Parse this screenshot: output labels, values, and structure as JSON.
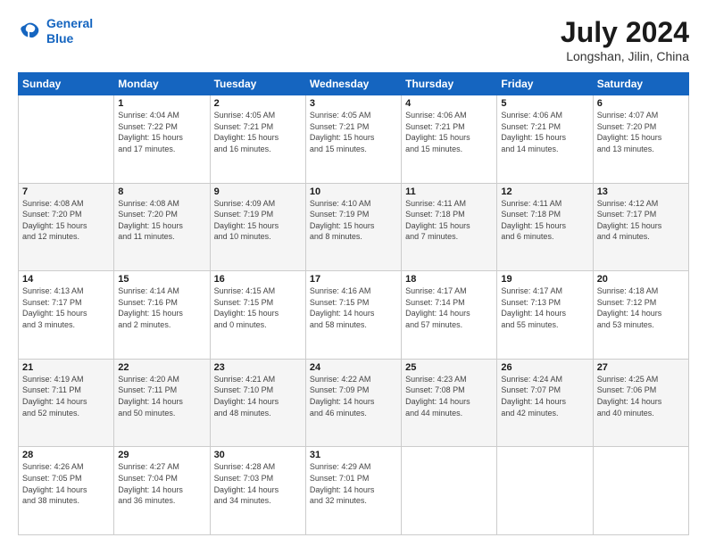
{
  "logo": {
    "line1": "General",
    "line2": "Blue"
  },
  "title": "July 2024",
  "location": "Longshan, Jilin, China",
  "days_of_week": [
    "Sunday",
    "Monday",
    "Tuesday",
    "Wednesday",
    "Thursday",
    "Friday",
    "Saturday"
  ],
  "weeks": [
    [
      {
        "day": "",
        "info": ""
      },
      {
        "day": "1",
        "info": "Sunrise: 4:04 AM\nSunset: 7:22 PM\nDaylight: 15 hours\nand 17 minutes."
      },
      {
        "day": "2",
        "info": "Sunrise: 4:05 AM\nSunset: 7:21 PM\nDaylight: 15 hours\nand 16 minutes."
      },
      {
        "day": "3",
        "info": "Sunrise: 4:05 AM\nSunset: 7:21 PM\nDaylight: 15 hours\nand 15 minutes."
      },
      {
        "day": "4",
        "info": "Sunrise: 4:06 AM\nSunset: 7:21 PM\nDaylight: 15 hours\nand 15 minutes."
      },
      {
        "day": "5",
        "info": "Sunrise: 4:06 AM\nSunset: 7:21 PM\nDaylight: 15 hours\nand 14 minutes."
      },
      {
        "day": "6",
        "info": "Sunrise: 4:07 AM\nSunset: 7:20 PM\nDaylight: 15 hours\nand 13 minutes."
      }
    ],
    [
      {
        "day": "7",
        "info": "Sunrise: 4:08 AM\nSunset: 7:20 PM\nDaylight: 15 hours\nand 12 minutes."
      },
      {
        "day": "8",
        "info": "Sunrise: 4:08 AM\nSunset: 7:20 PM\nDaylight: 15 hours\nand 11 minutes."
      },
      {
        "day": "9",
        "info": "Sunrise: 4:09 AM\nSunset: 7:19 PM\nDaylight: 15 hours\nand 10 minutes."
      },
      {
        "day": "10",
        "info": "Sunrise: 4:10 AM\nSunset: 7:19 PM\nDaylight: 15 hours\nand 8 minutes."
      },
      {
        "day": "11",
        "info": "Sunrise: 4:11 AM\nSunset: 7:18 PM\nDaylight: 15 hours\nand 7 minutes."
      },
      {
        "day": "12",
        "info": "Sunrise: 4:11 AM\nSunset: 7:18 PM\nDaylight: 15 hours\nand 6 minutes."
      },
      {
        "day": "13",
        "info": "Sunrise: 4:12 AM\nSunset: 7:17 PM\nDaylight: 15 hours\nand 4 minutes."
      }
    ],
    [
      {
        "day": "14",
        "info": "Sunrise: 4:13 AM\nSunset: 7:17 PM\nDaylight: 15 hours\nand 3 minutes."
      },
      {
        "day": "15",
        "info": "Sunrise: 4:14 AM\nSunset: 7:16 PM\nDaylight: 15 hours\nand 2 minutes."
      },
      {
        "day": "16",
        "info": "Sunrise: 4:15 AM\nSunset: 7:15 PM\nDaylight: 15 hours\nand 0 minutes."
      },
      {
        "day": "17",
        "info": "Sunrise: 4:16 AM\nSunset: 7:15 PM\nDaylight: 14 hours\nand 58 minutes."
      },
      {
        "day": "18",
        "info": "Sunrise: 4:17 AM\nSunset: 7:14 PM\nDaylight: 14 hours\nand 57 minutes."
      },
      {
        "day": "19",
        "info": "Sunrise: 4:17 AM\nSunset: 7:13 PM\nDaylight: 14 hours\nand 55 minutes."
      },
      {
        "day": "20",
        "info": "Sunrise: 4:18 AM\nSunset: 7:12 PM\nDaylight: 14 hours\nand 53 minutes."
      }
    ],
    [
      {
        "day": "21",
        "info": "Sunrise: 4:19 AM\nSunset: 7:11 PM\nDaylight: 14 hours\nand 52 minutes."
      },
      {
        "day": "22",
        "info": "Sunrise: 4:20 AM\nSunset: 7:11 PM\nDaylight: 14 hours\nand 50 minutes."
      },
      {
        "day": "23",
        "info": "Sunrise: 4:21 AM\nSunset: 7:10 PM\nDaylight: 14 hours\nand 48 minutes."
      },
      {
        "day": "24",
        "info": "Sunrise: 4:22 AM\nSunset: 7:09 PM\nDaylight: 14 hours\nand 46 minutes."
      },
      {
        "day": "25",
        "info": "Sunrise: 4:23 AM\nSunset: 7:08 PM\nDaylight: 14 hours\nand 44 minutes."
      },
      {
        "day": "26",
        "info": "Sunrise: 4:24 AM\nSunset: 7:07 PM\nDaylight: 14 hours\nand 42 minutes."
      },
      {
        "day": "27",
        "info": "Sunrise: 4:25 AM\nSunset: 7:06 PM\nDaylight: 14 hours\nand 40 minutes."
      }
    ],
    [
      {
        "day": "28",
        "info": "Sunrise: 4:26 AM\nSunset: 7:05 PM\nDaylight: 14 hours\nand 38 minutes."
      },
      {
        "day": "29",
        "info": "Sunrise: 4:27 AM\nSunset: 7:04 PM\nDaylight: 14 hours\nand 36 minutes."
      },
      {
        "day": "30",
        "info": "Sunrise: 4:28 AM\nSunset: 7:03 PM\nDaylight: 14 hours\nand 34 minutes."
      },
      {
        "day": "31",
        "info": "Sunrise: 4:29 AM\nSunset: 7:01 PM\nDaylight: 14 hours\nand 32 minutes."
      },
      {
        "day": "",
        "info": ""
      },
      {
        "day": "",
        "info": ""
      },
      {
        "day": "",
        "info": ""
      }
    ]
  ]
}
